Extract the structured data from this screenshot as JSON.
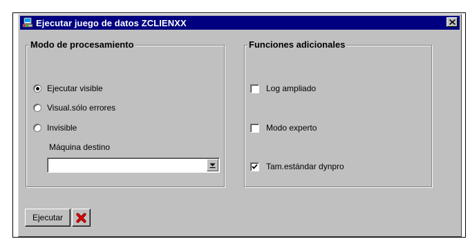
{
  "window": {
    "title": "Ejecutar juego de datos ZCLIENXX"
  },
  "processing_mode": {
    "title": "Modo de procesamiento",
    "options": [
      {
        "label": "Ejecutar visible",
        "selected": true
      },
      {
        "label": "Visual.sólo errores",
        "selected": false
      },
      {
        "label": "Invisible",
        "selected": false
      }
    ],
    "target_machine": {
      "label": "Máquina destino",
      "value": ""
    }
  },
  "additional_functions": {
    "title": "Funciones adicionales",
    "options": [
      {
        "label": "Log ampliado",
        "checked": false
      },
      {
        "label": "Modo experto",
        "checked": false
      },
      {
        "label": "Tam.estándar dynpro",
        "checked": true
      }
    ]
  },
  "toolbar": {
    "execute_label": "Ejecutar",
    "cancel_icon": "cancel-x-icon"
  },
  "colors": {
    "title_bar": "#000080",
    "face": "#c0c0c0",
    "cancel_red": "#e00000"
  }
}
